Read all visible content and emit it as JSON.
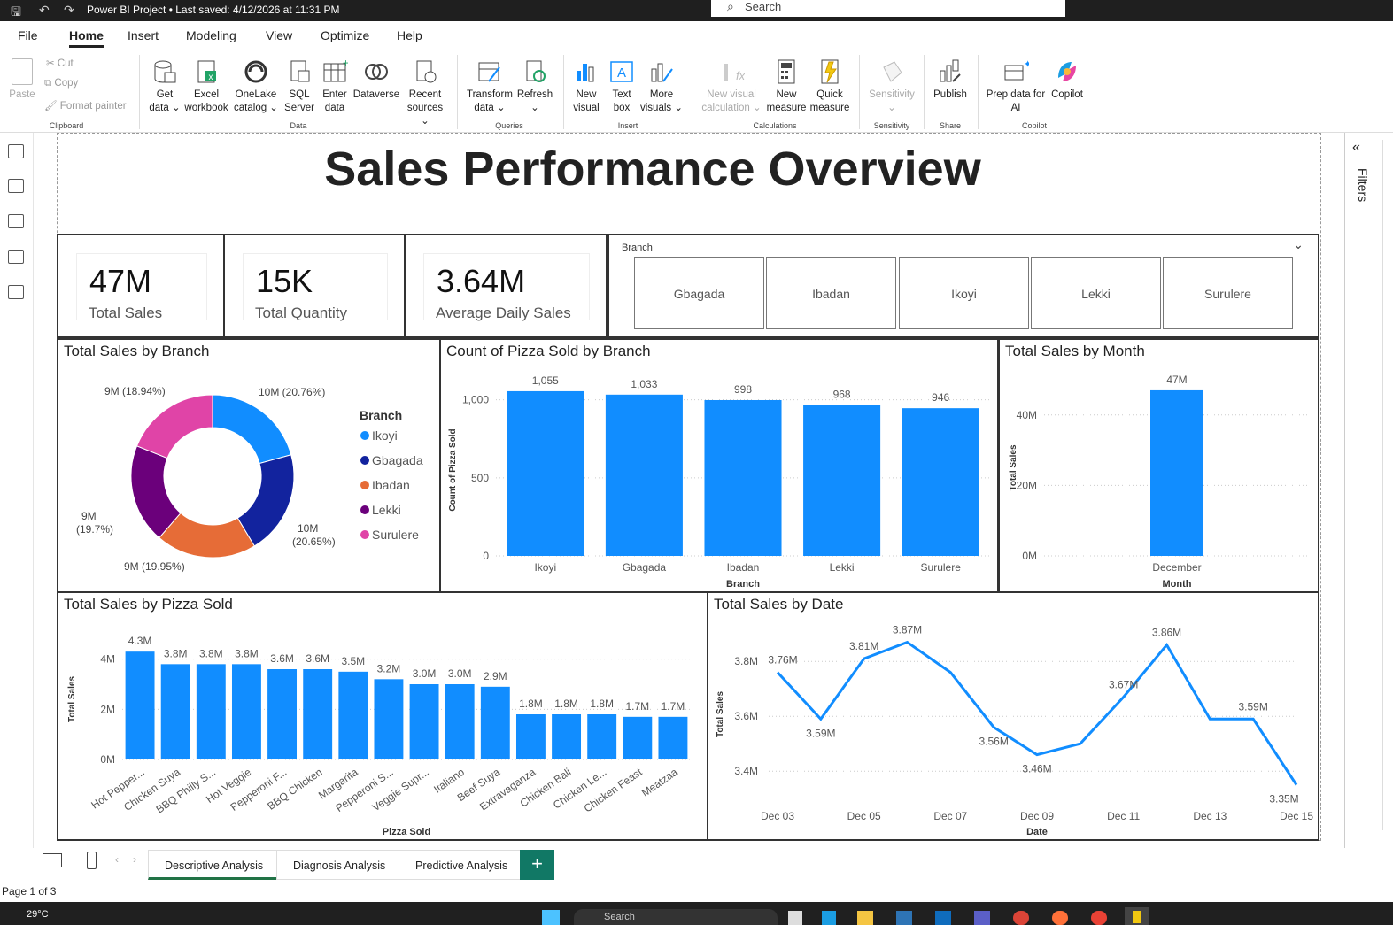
{
  "titlebar": {
    "title": "Power BI Project • Last saved: 4/12/2026 at 11:31 PM",
    "search_placeholder": "Search"
  },
  "menu": [
    "File",
    "Home",
    "Insert",
    "Modeling",
    "View",
    "Optimize",
    "Help"
  ],
  "ribbon": {
    "clipboard": {
      "paste": "Paste",
      "cut": "Cut",
      "copy": "Copy",
      "format_painter": "Format painter",
      "group": "Clipboard"
    },
    "data": {
      "get_data": "Get data ⌄",
      "excel": "Excel workbook",
      "onelake": "OneLake catalog ⌄",
      "sql": "SQL Server",
      "enter": "Enter data",
      "dataverse": "Dataverse",
      "recent": "Recent sources ⌄",
      "group": "Data"
    },
    "queries": {
      "transform": "Transform data ⌄",
      "refresh": "Refresh ⌄",
      "group": "Queries"
    },
    "insert": {
      "new_visual": "New visual",
      "text_box": "Text box",
      "more_visuals": "More visuals ⌄",
      "group": "Insert"
    },
    "calculations": {
      "new_visual_calc": "New visual calculation ⌄",
      "new_measure": "New measure",
      "quick_measure": "Quick measure",
      "group": "Calculations"
    },
    "sensitivity": {
      "label": "Sensitivity ⌄",
      "group": "Sensitivity"
    },
    "share": {
      "publish": "Publish",
      "group": "Share"
    },
    "copilot": {
      "prep": "Prep data for AI",
      "copilot": "Copilot",
      "group": "Copilot"
    }
  },
  "right_rail": {
    "filters": "Filters"
  },
  "report": {
    "title": "Sales Performance Overview",
    "cards": [
      {
        "value": "47M",
        "label": "Total Sales"
      },
      {
        "value": "15K",
        "label": "Total Quantity"
      },
      {
        "value": "3.64M",
        "label": "Average Daily Sales"
      }
    ],
    "slicer": {
      "title": "Branch",
      "options": [
        "Gbagada",
        "Ibadan",
        "Ikoyi",
        "Lekki",
        "Surulere"
      ]
    }
  },
  "chart_data": [
    {
      "type": "pie",
      "title": "Total Sales by Branch",
      "legend_title": "Branch",
      "legend_position": "right",
      "slices": [
        {
          "name": "Ikoyi",
          "percent": 20.76,
          "label": "10M (20.76%)",
          "color": "#118DFF"
        },
        {
          "name": "Gbagada",
          "percent": 20.65,
          "label": "10M (20.65%)",
          "color": "#12239E"
        },
        {
          "name": "Ibadan",
          "percent": 19.95,
          "label": "9M (19.95%)",
          "color": "#E66C37"
        },
        {
          "name": "Lekki",
          "percent": 19.7,
          "label": "9M (19.7%)",
          "color": "#6B007B"
        },
        {
          "name": "Surulere",
          "percent": 18.94,
          "label": "9M (18.94%)",
          "color": "#E044A7"
        }
      ]
    },
    {
      "type": "bar",
      "title": "Count of Pizza Sold by Branch",
      "xlabel": "Branch",
      "ylabel": "Count of Pizza Sold",
      "categories": [
        "Ikoyi",
        "Gbagada",
        "Ibadan",
        "Lekki",
        "Surulere"
      ],
      "values": [
        1055,
        1033,
        998,
        968,
        946
      ],
      "ylim": [
        0,
        1100
      ],
      "yticks": [
        {
          "v": 0,
          "t": "0"
        },
        {
          "v": 500,
          "t": "500"
        },
        {
          "v": 1000,
          "t": "1,000"
        }
      ],
      "color": "#118DFF"
    },
    {
      "type": "bar",
      "title": "Total Sales by Month",
      "xlabel": "Month",
      "ylabel": "Total Sales",
      "categories": [
        "December"
      ],
      "values": [
        47
      ],
      "value_labels": [
        "47M"
      ],
      "ylim": [
        0,
        50
      ],
      "yticks": [
        {
          "v": 0,
          "t": "0M"
        },
        {
          "v": 20,
          "t": "20M"
        },
        {
          "v": 40,
          "t": "40M"
        }
      ],
      "color": "#118DFF"
    },
    {
      "type": "bar",
      "title": "Total Sales by Pizza Sold",
      "xlabel": "Pizza Sold",
      "ylabel": "Total Sales",
      "categories": [
        "Hot Pepper...",
        "Chicken Suya",
        "BBQ Philly S...",
        "Hot Veggie",
        "Pepperoni F...",
        "BBQ Chicken",
        "Margarita",
        "Pepperoni S...",
        "Veggie Supr...",
        "Italiano",
        "Beef Suya",
        "Extravaganza",
        "Chicken Bali",
        "Chicken Le...",
        "Chicken Feast",
        "Meatzaa"
      ],
      "values": [
        4.3,
        3.8,
        3.8,
        3.8,
        3.6,
        3.6,
        3.5,
        3.2,
        3.0,
        3.0,
        2.9,
        1.8,
        1.8,
        1.8,
        1.7,
        1.7
      ],
      "value_labels": [
        "4.3M",
        "3.8M",
        "3.8M",
        "3.8M",
        "3.6M",
        "3.6M",
        "3.5M",
        "3.2M",
        "3.0M",
        "3.0M",
        "2.9M",
        "1.8M",
        "1.8M",
        "1.8M",
        "1.7M",
        "1.7M"
      ],
      "ylim": [
        0,
        4.8
      ],
      "yticks": [
        {
          "v": 0,
          "t": "0M"
        },
        {
          "v": 2,
          "t": "2M"
        },
        {
          "v": 4,
          "t": "4M"
        }
      ],
      "color": "#118DFF"
    },
    {
      "type": "line",
      "title": "Total Sales by Date",
      "xlabel": "Date",
      "ylabel": "Total Sales",
      "x": [
        "Dec 03",
        "Dec 04",
        "Dec 05",
        "Dec 06",
        "Dec 07",
        "Dec 08",
        "Dec 09",
        "Dec 10",
        "Dec 11",
        "Dec 12",
        "Dec 13",
        "Dec 14",
        "Dec 15"
      ],
      "values": [
        3.76,
        3.59,
        3.81,
        3.87,
        3.76,
        3.56,
        3.46,
        3.5,
        3.67,
        3.86,
        3.59,
        3.59,
        3.35
      ],
      "value_labels": [
        "3.76M",
        "3.59M",
        "3.81M",
        "3.87M",
        "",
        "3.56M",
        "3.46M",
        "",
        "3.67M",
        "3.86M",
        "",
        "3.59M",
        "3.35M"
      ],
      "xticks": [
        "Dec 03",
        "Dec 05",
        "Dec 07",
        "Dec 09",
        "Dec 11",
        "Dec 13",
        "Dec 15"
      ],
      "ylim": [
        3.32,
        3.92
      ],
      "yticks": [
        {
          "v": 3.4,
          "t": "3.4M"
        },
        {
          "v": 3.6,
          "t": "3.6M"
        },
        {
          "v": 3.8,
          "t": "3.8M"
        }
      ],
      "color": "#118DFF"
    }
  ],
  "tabs": [
    "Descriptive Analysis",
    "Diagnosis Analysis",
    "Predictive Analysis"
  ],
  "add_page": "+",
  "status": {
    "page": "Page 1 of 3"
  },
  "taskbar": {
    "weather": "29°C",
    "search": "Search"
  }
}
